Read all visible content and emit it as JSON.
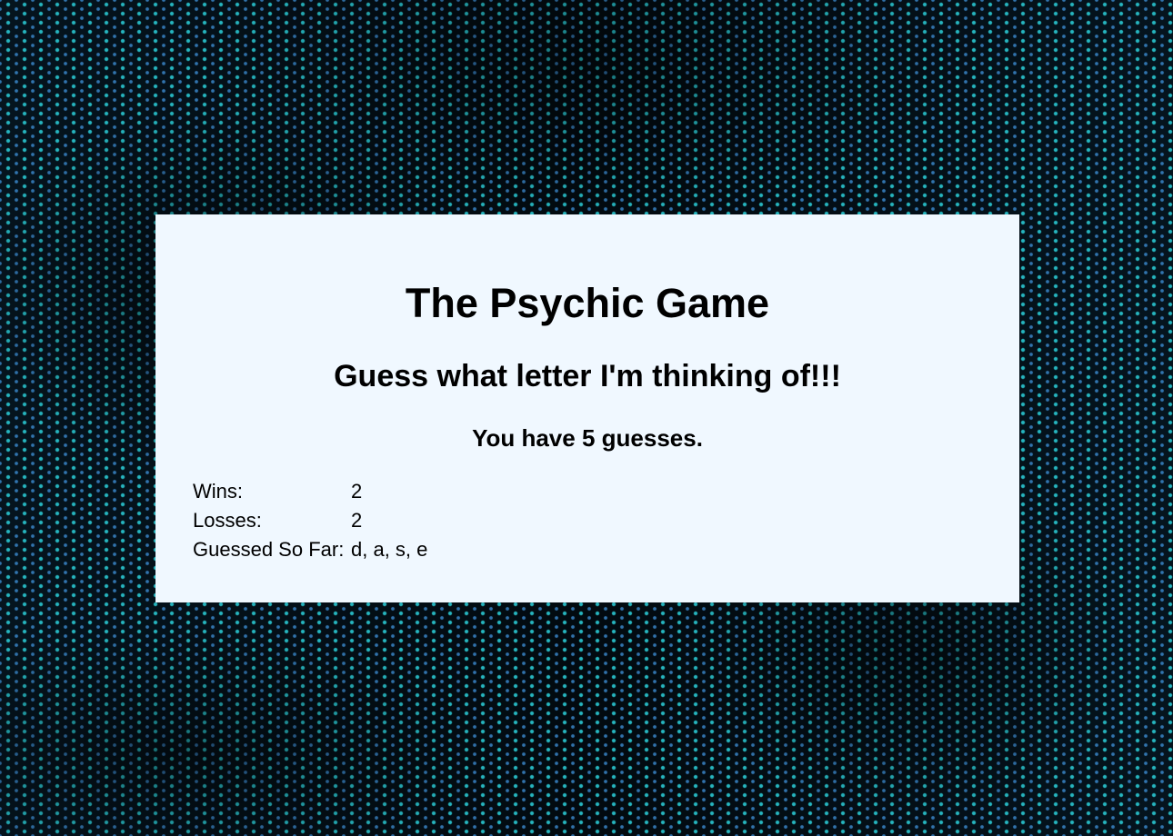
{
  "game": {
    "title": "The Psychic Game",
    "subtitle": "Guess what letter I'm thinking of!!!",
    "guesses_text": "You have 5 guesses."
  },
  "stats": {
    "wins_label": "Wins:",
    "wins_value": "2",
    "losses_label": "Losses:",
    "losses_value": "2",
    "guessed_label": "Guessed So Far:",
    "guessed_value": "d, a, s, e"
  },
  "colors": {
    "panel_background": "#f0f8ff",
    "text": "#000000",
    "background_dots": "#28bec8"
  }
}
